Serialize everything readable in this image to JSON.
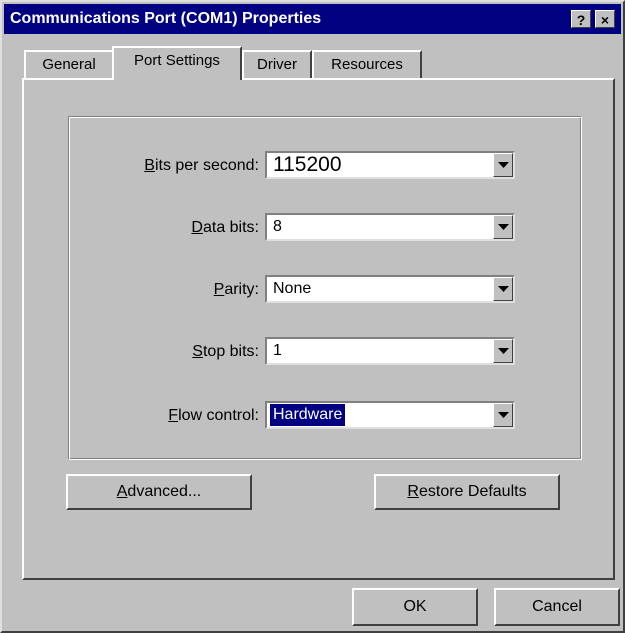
{
  "window": {
    "title": "Communications Port (COM1) Properties",
    "help_button": "?",
    "close_button": "×"
  },
  "tabs": [
    {
      "label": "General",
      "active": false
    },
    {
      "label": "Port Settings",
      "active": true
    },
    {
      "label": "Driver",
      "active": false
    },
    {
      "label": "Resources",
      "active": false
    }
  ],
  "fields": {
    "bits_per_second": {
      "label_mnemonic": "B",
      "label_rest": "its per second:",
      "value": "115200"
    },
    "data_bits": {
      "label_mnemonic": "D",
      "label_rest": "ata bits:",
      "value": "8"
    },
    "parity": {
      "label_mnemonic": "P",
      "label_rest": "arity:",
      "value": "None"
    },
    "stop_bits": {
      "label_mnemonic": "S",
      "label_rest": "top bits:",
      "value": "1"
    },
    "flow_control": {
      "label_mnemonic": "F",
      "label_rest": "low control:",
      "value": "Hardware"
    }
  },
  "buttons": {
    "advanced": {
      "mnemonic": "A",
      "rest": "dvanced..."
    },
    "restore_defaults": {
      "mnemonic": "R",
      "rest": "estore Defaults"
    },
    "ok": "OK",
    "cancel": "Cancel"
  },
  "icons": {
    "dropdown": "chevron-down-icon"
  }
}
